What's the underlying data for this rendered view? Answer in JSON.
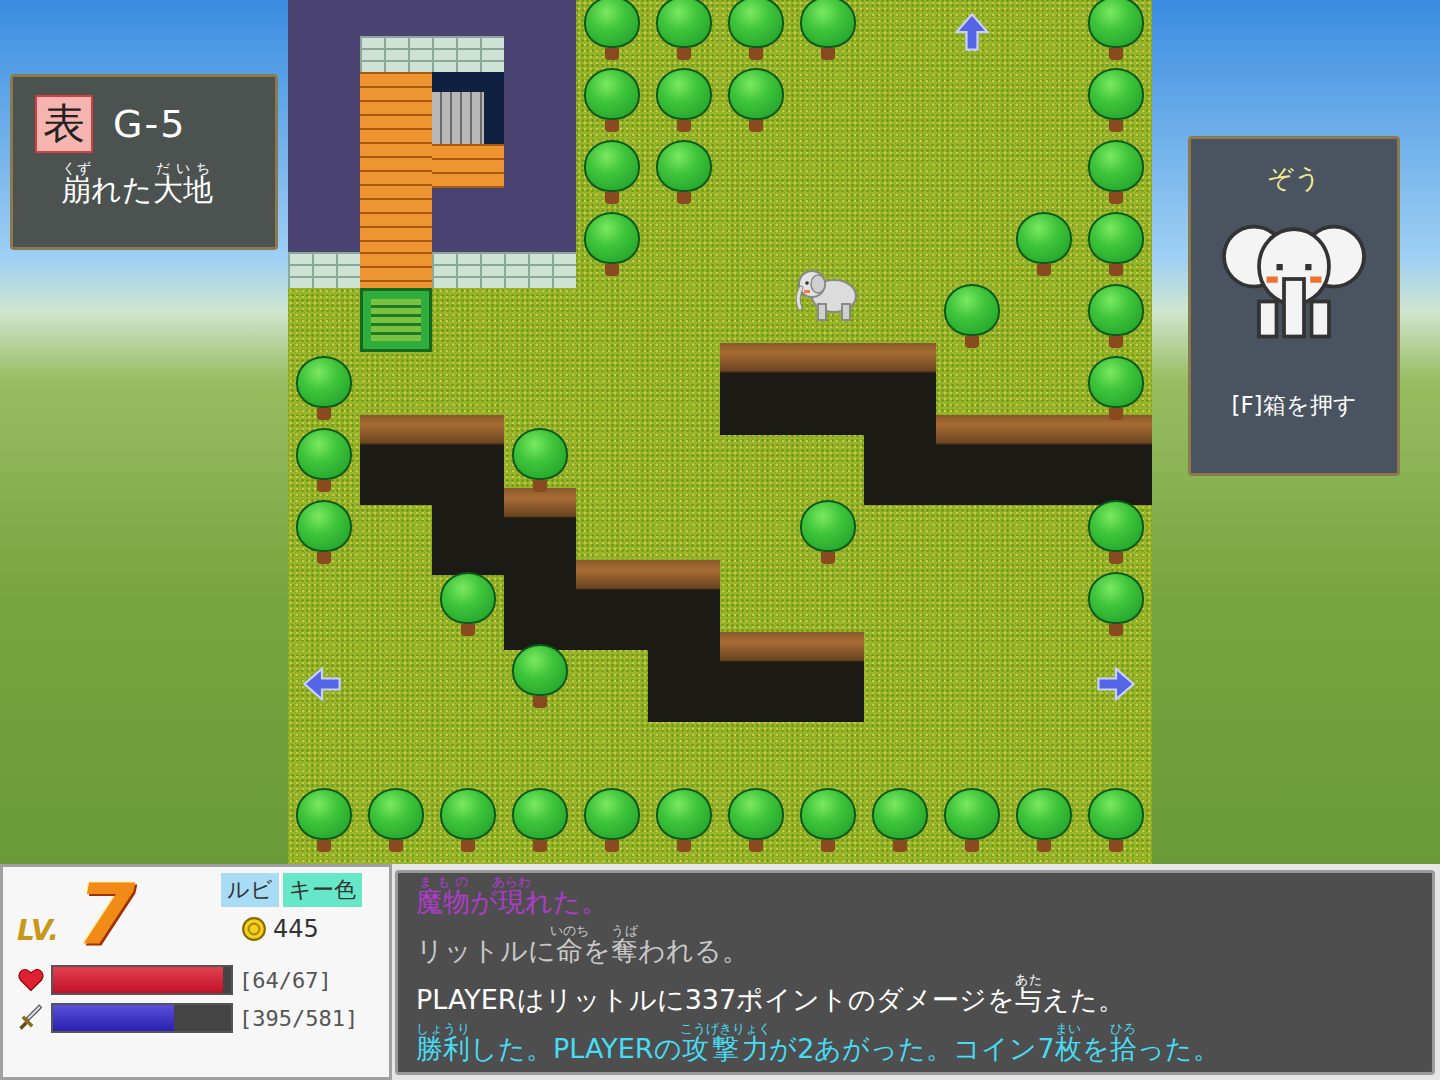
{
  "location": {
    "side": "表",
    "code": "G-5",
    "name": [
      {
        "text": "崩",
        "ruby": "くず"
      },
      {
        "text": "れた",
        "ruby": ""
      },
      {
        "text": "大地",
        "ruby": "だいち"
      }
    ]
  },
  "target": {
    "name": "ぞう",
    "action": "[F]箱を押す"
  },
  "status": {
    "level_label": "LV.",
    "level": "7",
    "badges": [
      {
        "label": "ルビ",
        "color": "#a8dcf4"
      },
      {
        "label": "キー色",
        "color": "#66e8c8"
      }
    ],
    "coins": "445",
    "hp": {
      "level": 0.955,
      "reading": "[64/67]"
    },
    "mp": {
      "level": 0.68,
      "reading": "[395/581]"
    }
  },
  "messages": [
    {
      "color": "#b03ccc",
      "segments": [
        {
          "text": "魔物",
          "ruby": "まもの"
        },
        {
          "text": "が",
          "ruby": ""
        },
        {
          "text": "現",
          "ruby": "あらわ"
        },
        {
          "text": "れた。",
          "ruby": ""
        }
      ]
    },
    {
      "color": "#c8c8c8",
      "segments": [
        {
          "text": "リットルに",
          "ruby": ""
        },
        {
          "text": "命",
          "ruby": "いのち"
        },
        {
          "text": "を",
          "ruby": ""
        },
        {
          "text": "奪",
          "ruby": "うば"
        },
        {
          "text": "われる。",
          "ruby": ""
        }
      ]
    },
    {
      "color": "#ffffff",
      "segments": [
        {
          "text": "PLAYERはリットルに337ポイントのダメージを",
          "ruby": ""
        },
        {
          "text": "与",
          "ruby": "あた"
        },
        {
          "text": "えた。",
          "ruby": ""
        }
      ]
    },
    {
      "color": "#48dcf4",
      "segments": [
        {
          "text": "勝利",
          "ruby": "しょうり"
        },
        {
          "text": "した。PLAYERの",
          "ruby": ""
        },
        {
          "text": "攻撃力",
          "ruby": "こうげきりょく"
        },
        {
          "text": "が2あがった。コイン7",
          "ruby": ""
        },
        {
          "text": "枚",
          "ruby": "まい"
        },
        {
          "text": "を",
          "ruby": ""
        },
        {
          "text": "拾",
          "ruby": "ひろ"
        },
        {
          "text": "った。",
          "ruby": ""
        }
      ]
    }
  ]
}
